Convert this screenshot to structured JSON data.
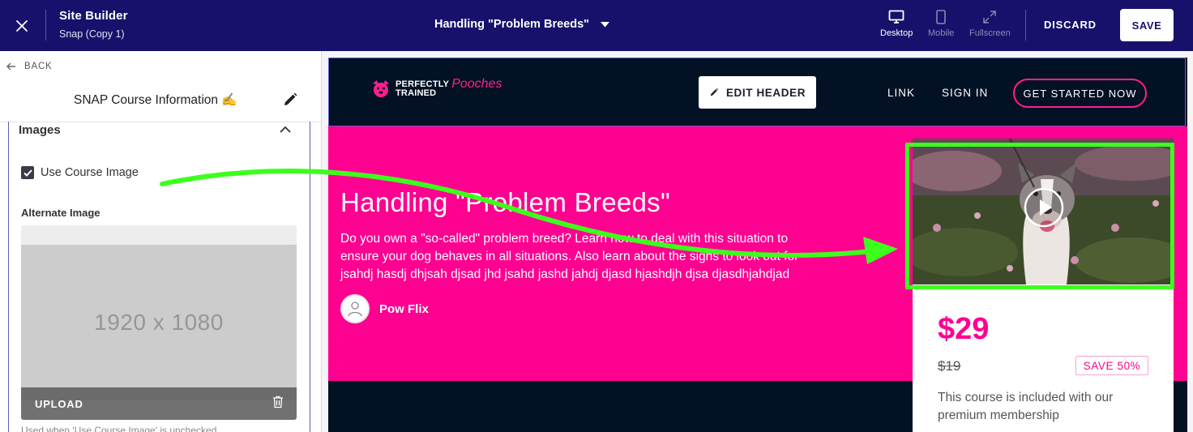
{
  "topbar": {
    "app_title": "Site Builder",
    "app_subtitle": "Snap (Copy 1)",
    "page_selector": "Handling \"Problem Breeds\"",
    "devices": [
      {
        "label": "Desktop",
        "icon": "desktop-icon",
        "active": true
      },
      {
        "label": "Mobile",
        "icon": "mobile-icon",
        "active": false
      },
      {
        "label": "Fullscreen",
        "icon": "fullscreen-icon",
        "active": false
      }
    ],
    "discard_label": "DISCARD",
    "save_label": "SAVE"
  },
  "left_panel": {
    "back_label": "BACK",
    "title": "SNAP Course Information ✍️",
    "section_title": "Images",
    "use_course_image_label": "Use Course Image",
    "use_course_image_checked": true,
    "alternate_image_label": "Alternate Image",
    "placeholder_text": "1920 x 1080",
    "upload_label": "UPLOAD",
    "help_text": "Used when 'Use Course Image' is unchecked"
  },
  "site": {
    "logo": {
      "line1": "PERFECTLY",
      "line2": "TRAINED",
      "script": "Pooches"
    },
    "edit_header_label": "EDIT HEADER",
    "nav": [
      {
        "label": "LINK"
      },
      {
        "label": "SIGN IN"
      }
    ],
    "cta_label": "GET STARTED NOW",
    "hero_title": "Handling \"Problem Breeds\"",
    "hero_description": "Do you own a \"so-called\" problem breed? Learn how to deal with this situation to ensure your dog behaves in all situations. Also learn about the signs to look out for jsahdj hasdj dhjsah djsad jhd jsahd jashd jahdj djasd hjashdjh djsa djasdhjahdjad",
    "author_name": "Pow Flix",
    "price": "$29",
    "old_price": "$19",
    "save_badge": "SAVE 50%",
    "card_description": "This course is included with our premium membership"
  },
  "colors": {
    "topbar": "#17116b",
    "hero_pink": "#fe0190",
    "site_dark": "#031125",
    "annotation_green": "#3dff1e"
  }
}
